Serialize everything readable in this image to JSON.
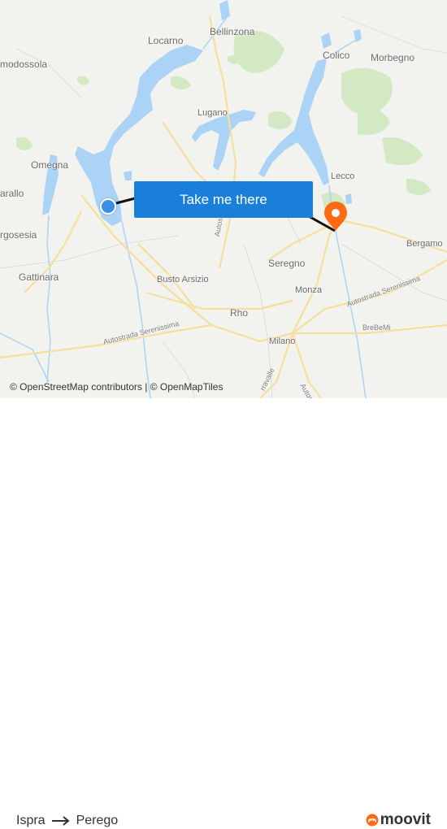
{
  "map": {
    "places": [
      {
        "id": "locarno",
        "name": "Locarno"
      },
      {
        "id": "bellinzona",
        "name": "Bellinzona"
      },
      {
        "id": "domodossola",
        "name": "modossola"
      },
      {
        "id": "colico",
        "name": "Colico"
      },
      {
        "id": "morbegno",
        "name": "Morbegno"
      },
      {
        "id": "lugano",
        "name": "Lugano"
      },
      {
        "id": "omegna",
        "name": "Omegna"
      },
      {
        "id": "varallo",
        "name": "arallo"
      },
      {
        "id": "borgosesia",
        "name": "rgosesia"
      },
      {
        "id": "lecco",
        "name": "Lecco"
      },
      {
        "id": "bergamo",
        "name": "Bergamo"
      },
      {
        "id": "seregno",
        "name": "Seregno"
      },
      {
        "id": "gattinara",
        "name": "Gattinara"
      },
      {
        "id": "busto-arsizio",
        "name": "Busto Arsizio"
      },
      {
        "id": "monza",
        "name": "Monza"
      },
      {
        "id": "rho",
        "name": "Rho"
      },
      {
        "id": "milano",
        "name": "Milano"
      }
    ],
    "roads": [
      {
        "id": "autostrada-dei-laghi",
        "name": "Autostrada dei"
      },
      {
        "id": "autostrada-serenissima-1",
        "name": "Autostrada Serenissima"
      },
      {
        "id": "autostrada-serenissima-2",
        "name": "Autostrada Serenissima"
      },
      {
        "id": "brebemi",
        "name": "BreBeMi"
      },
      {
        "id": "tangenziale",
        "name": "rravalle"
      },
      {
        "id": "autostrada-south",
        "name": "Autos"
      }
    ],
    "cta_label": "Take me there",
    "attribution": "© OpenStreetMap contributors | © OpenMapTiles",
    "colors": {
      "water": "#aad3f5",
      "green": "#cfe8bf",
      "land": "#f2f2ef",
      "road": "#f6df9c",
      "cta": "#1a7fd9",
      "origin": "#3a8ee8",
      "destination": "#ff6a13"
    }
  },
  "footer": {
    "origin": "Ispra",
    "arrow_icon": "arrow-right",
    "destination": "Perego",
    "brand": "moovit",
    "brand_icon": "moovit-logo"
  }
}
